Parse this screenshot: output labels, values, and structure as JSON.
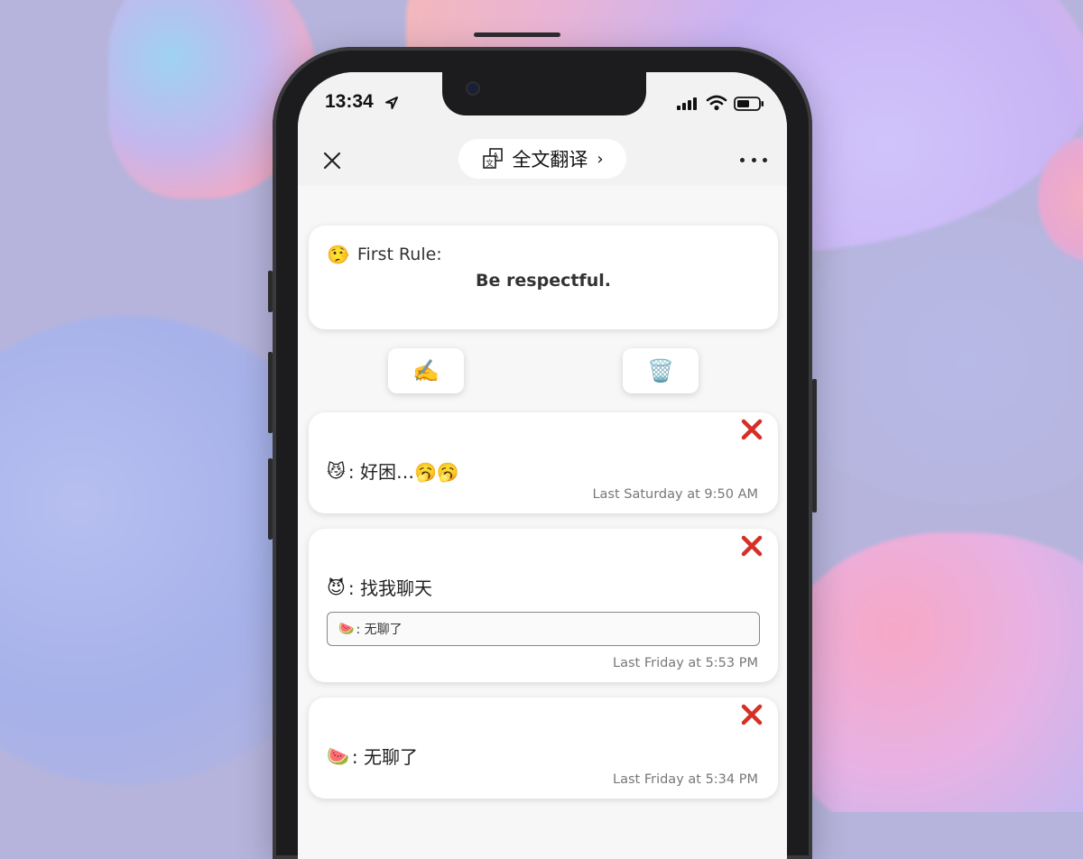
{
  "status_bar": {
    "time": "13:34"
  },
  "nav": {
    "translate_label": "全文翻译",
    "translate_chevron": "›"
  },
  "rule": {
    "emoji": "🤥",
    "label": "First Rule:",
    "text": "Be respectful."
  },
  "actions": {
    "edit_emoji": "✍️",
    "trash_emoji": "🗑️"
  },
  "messages": [
    {
      "emoji": "😼",
      "text": ": 好困…🥱🥱",
      "time": "Last Saturday at 9:50 AM"
    },
    {
      "emoji": "😈",
      "text": ": 找我聊天",
      "quote_emoji": "🍉",
      "quote": ": 无聊了",
      "time": "Last Friday at 5:53 PM"
    },
    {
      "emoji": "🍉",
      "text": ": 无聊了",
      "time": "Last Friday at 5:34 PM"
    }
  ],
  "colors": {
    "delete_x": "#d62f27",
    "background": "#b6b4dc"
  }
}
